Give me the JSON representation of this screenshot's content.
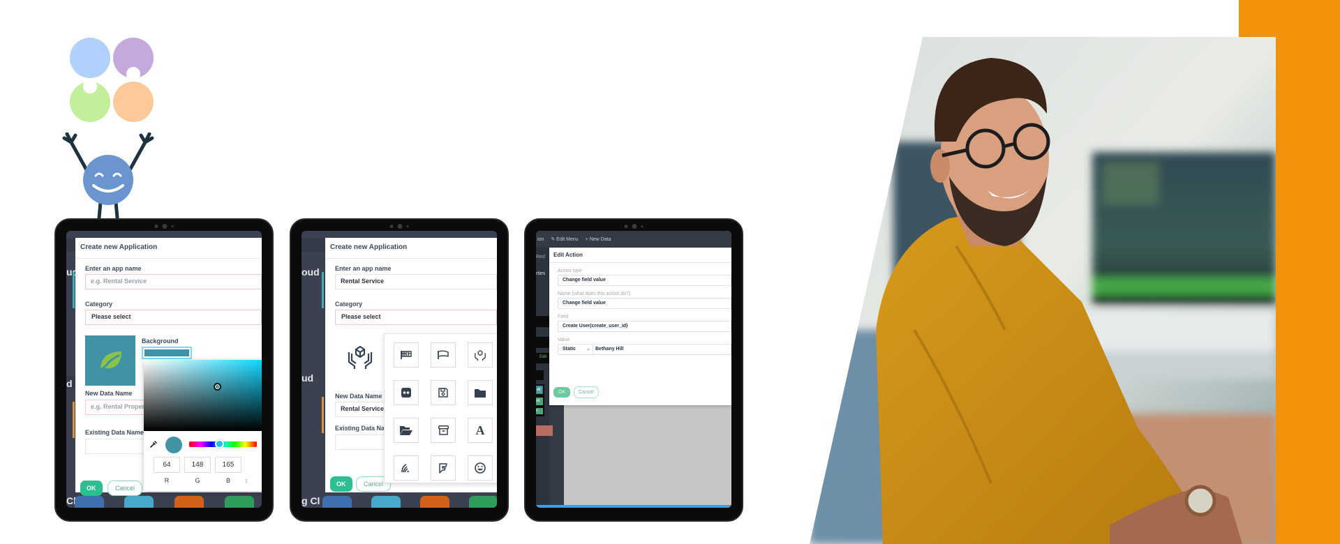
{
  "brand": {
    "logo_circles": [
      "#b0d1fb",
      "#c4a9dc",
      "#c3ee9a",
      "#fcca9a"
    ],
    "mascot_color": "#6a95ce",
    "accent_orange": "#f2920b"
  },
  "tablet1": {
    "side_texts": [
      "ud",
      "d",
      "Cl"
    ],
    "dialog_title": "Create new Application",
    "app_name_label": "Enter an app name",
    "app_name_placeholder": "e.g. Rental Service",
    "category_label": "Category",
    "category_value": "Please select",
    "background_label": "Background",
    "icon": "leaf-icon",
    "new_data_label": "New Data Name",
    "new_data_placeholder": "e.g. Rental Proper",
    "existing_data_label": "Existing Data Name",
    "ok_label": "OK",
    "cancel_label": "Cancel",
    "color_picker": {
      "r": "64",
      "g": "148",
      "b": "165",
      "r_label": "R",
      "g_label": "G",
      "b_label": "B",
      "mode_toggle": "↕",
      "color": "#4094a5"
    }
  },
  "tablet2": {
    "side_texts": [
      "oud",
      "ud",
      "g Cl"
    ],
    "dialog_title": "Create new Application",
    "app_name_label": "Enter an app name",
    "app_name_value": "Rental Service",
    "category_label": "Category",
    "category_value": "Please select",
    "selected_icon": "hands-holding-box-icon",
    "new_data_label": "New Data Name",
    "new_data_value": "Rental Service",
    "existing_data_label": "Existing Data Nam",
    "ok_label": "OK",
    "cancel_label": "Cancel",
    "icon_grid": [
      "flag-checkered-icon",
      "flag-icon",
      "hands-holding-box-icon",
      "flickr-icon",
      "floppy-disk-icon",
      "folder-icon",
      "folder-open-icon",
      "archive-box-icon",
      "font-icon",
      "signal-stream-icon",
      "foursquare-icon",
      "grin-face-icon"
    ]
  },
  "tablet3": {
    "topbar": {
      "left_text": "ion",
      "edit_menu": "Edit Menu",
      "new_data": "New Data"
    },
    "side_texts": [
      "Red",
      "rties",
      "Edit"
    ],
    "dialog_title": "Edit Action",
    "action_type_label": "Action type",
    "action_type_value": "Change field value",
    "name_label": "Name (what does this action do?)",
    "name_value": "Change field value",
    "field_label": "Field",
    "field_value": "Create User(create_user_id)",
    "value_label": "Value",
    "value_mode": "Static",
    "value_value": "Bethany Hill",
    "ok_label": "OK",
    "cancel_label": "Cancel",
    "side_buttons": [
      "dit",
      "dit",
      "n"
    ]
  },
  "photo": {
    "description": "smiling man with glasses in mustard shirt at desk with monitors"
  }
}
